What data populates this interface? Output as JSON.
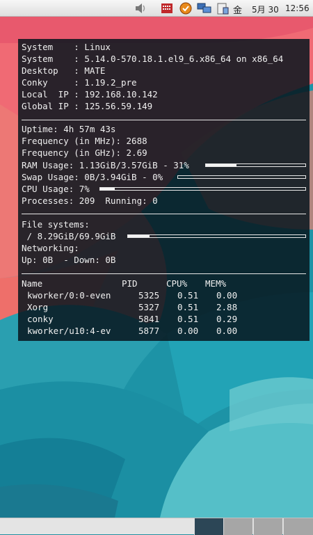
{
  "top_panel": {
    "tray": {
      "weekday": "金",
      "date": "5月 30",
      "time": "12:56",
      "icons": [
        "volume-icon",
        "system-monitor-icon",
        "update-notifier-icon",
        "network-icon",
        "clipboard-icon"
      ]
    }
  },
  "conky": {
    "system_info": [
      {
        "label": "System    ",
        "value": "Linux"
      },
      {
        "label": "System    ",
        "value": "5.14.0-570.18.1.el9_6.x86_64 on x86_64"
      },
      {
        "label": "Desktop   ",
        "value": "MATE"
      },
      {
        "label": "Conky     ",
        "value": "1.19.2_pre"
      },
      {
        "label": "Local  IP ",
        "value": "192.168.10.142"
      },
      {
        "label": "Global IP ",
        "value": "125.56.59.149"
      }
    ],
    "uptime": "Uptime: 4h 57m 43s",
    "freq_mhz": "Frequency (in MHz): 2688",
    "freq_ghz": "Frequency (in GHz): 2.69",
    "ram_text": "RAM Usage: 1.13GiB/3.57GiB - 31%",
    "ram_pct": 31,
    "swap_text": "Swap Usage: 0B/3.94GiB - 0%",
    "swap_pct": 0,
    "cpu_text": "CPU Usage: 7%",
    "cpu_pct": 7,
    "processes": "Processes: 209  Running: 0",
    "fs_title": "File systems:",
    "fs_root_text": " / 8.29GiB/69.9GiB",
    "fs_root_pct": 12,
    "net_title": "Networking:",
    "net_rates": "Up: 0B  - Down: 0B",
    "process_table": {
      "headers": {
        "name": "Name",
        "pid": "PID",
        "cpu": "CPU%",
        "mem": "MEM%"
      },
      "rows": [
        {
          "name": "kworker/0:0-even",
          "pid": "5325",
          "cpu": "0.51",
          "mem": "0.00"
        },
        {
          "name": "Xorg",
          "pid": "5327",
          "cpu": "0.51",
          "mem": "2.88"
        },
        {
          "name": "conky",
          "pid": "5841",
          "cpu": "0.51",
          "mem": "0.29"
        },
        {
          "name": "kworker/u10:4-ev",
          "pid": "5877",
          "cpu": "0.00",
          "mem": "0.00"
        }
      ]
    }
  },
  "bottom_panel": {
    "workspaces": [
      {
        "name": "workspace-1",
        "active": true
      },
      {
        "name": "workspace-2",
        "active": false
      },
      {
        "name": "workspace-3",
        "active": false
      },
      {
        "name": "workspace-4",
        "active": false
      }
    ]
  }
}
